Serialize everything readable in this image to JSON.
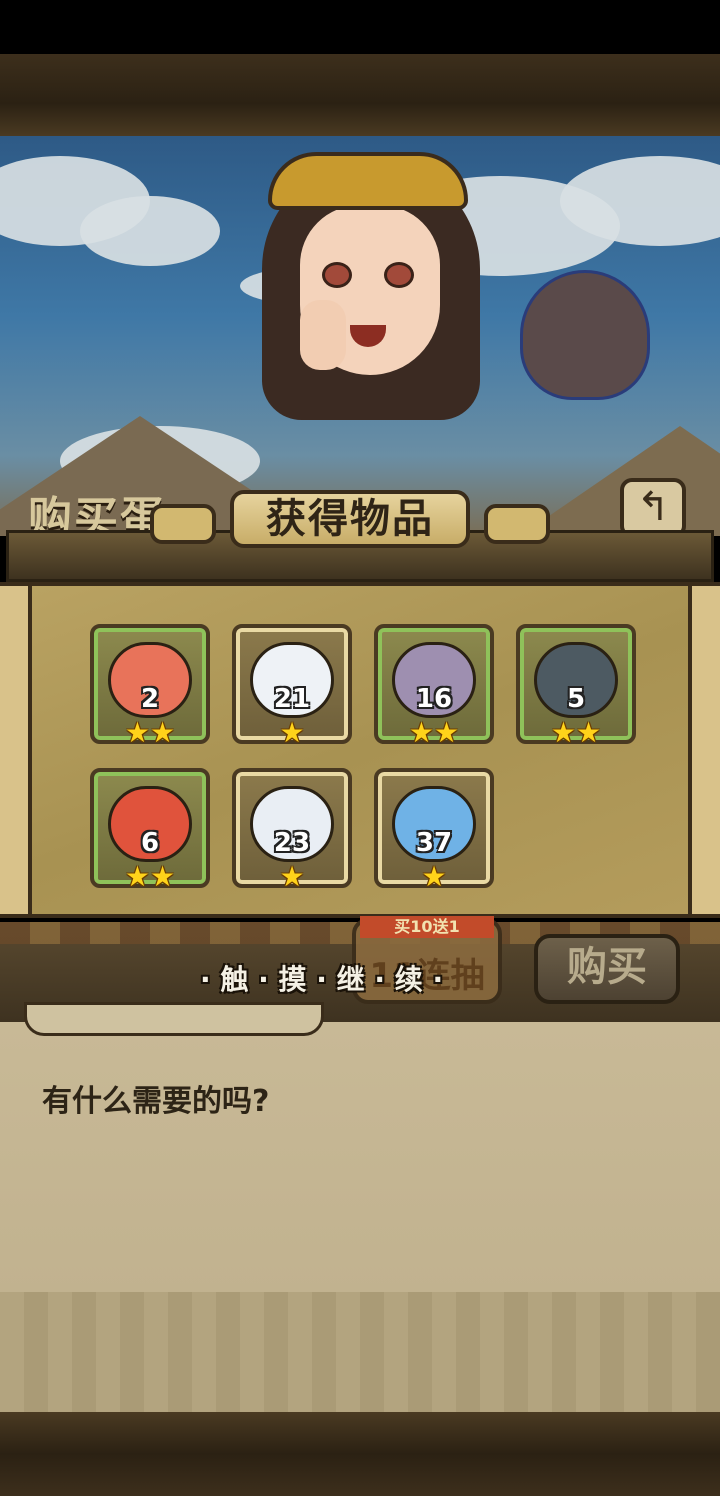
{
  "shop": {
    "title": "购买蛋"
  },
  "dialog": {
    "title": "获得物品",
    "items": [
      {
        "name": "shrimp",
        "count": "2",
        "stars": "★★",
        "frame": "green",
        "color": "#e8735a"
      },
      {
        "name": "feather-egg",
        "count": "21",
        "stars": "★",
        "frame": "beige",
        "color": "#eef2f6"
      },
      {
        "name": "shell",
        "count": "16",
        "stars": "★★",
        "frame": "green",
        "color": "#9e8fb0"
      },
      {
        "name": "turtle-shell",
        "count": "5",
        "stars": "★★",
        "frame": "green",
        "color": "#4d5a62"
      },
      {
        "name": "crab",
        "count": "6",
        "stars": "★★",
        "frame": "green",
        "color": "#e0533c"
      },
      {
        "name": "white-swirl",
        "count": "23",
        "stars": "★",
        "frame": "beige",
        "color": "#e9eef4"
      },
      {
        "name": "blue-slime",
        "count": "37",
        "stars": "★",
        "frame": "beige",
        "color": "#6fb2e6"
      }
    ]
  },
  "bottom": {
    "continue": "· 触 · 摸 · 继 · 续 ·",
    "lottery_top": "买10送1",
    "lottery_main": "11连抽",
    "buy": "购买"
  },
  "speech": {
    "text": "有什么需要的吗?"
  }
}
